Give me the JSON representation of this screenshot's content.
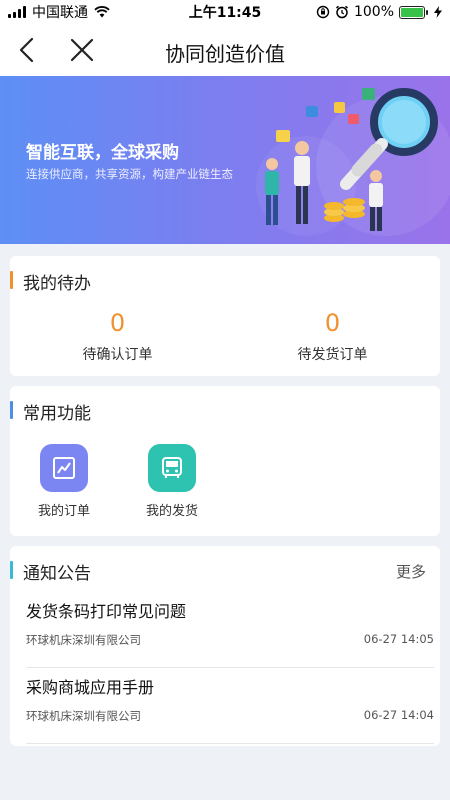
{
  "status_bar": {
    "carrier": "中国联通",
    "time": "上午11:45",
    "battery": "100%",
    "battery_level": 1.0,
    "icons": [
      "signal-icon",
      "wifi-icon",
      "orientation-lock-icon",
      "alarm-icon",
      "battery-icon",
      "charging-icon"
    ]
  },
  "nav": {
    "title": "协同创造价值",
    "back_icon": "chevron-left-icon",
    "close_icon": "close-icon"
  },
  "banner": {
    "title": "智能互联，全球采购",
    "subtitle": "连接供应商，共享资源，构建产业链生态"
  },
  "todo": {
    "title": "我的待办",
    "accent_color": "#f0912f",
    "items": [
      {
        "count": "0",
        "label": "待确认订单"
      },
      {
        "count": "0",
        "label": "待发货订单"
      }
    ]
  },
  "functions": {
    "title": "常用功能",
    "accent_color": "#4a8fe8",
    "items": [
      {
        "label": "我的订单",
        "icon": "chart-icon",
        "color": "#7b86f2"
      },
      {
        "label": "我的发货",
        "icon": "bus-icon",
        "color": "#2ec3b0"
      }
    ]
  },
  "notices": {
    "title": "通知公告",
    "accent_color": "#3bb8d8",
    "more": "更多",
    "items": [
      {
        "title": "发货条码打印常见问题",
        "company": "环球机床深圳有限公司",
        "time": "06-27 14:05"
      },
      {
        "title": "采购商城应用手册",
        "company": "环球机床深圳有限公司",
        "time": "06-27 14:04"
      }
    ]
  }
}
